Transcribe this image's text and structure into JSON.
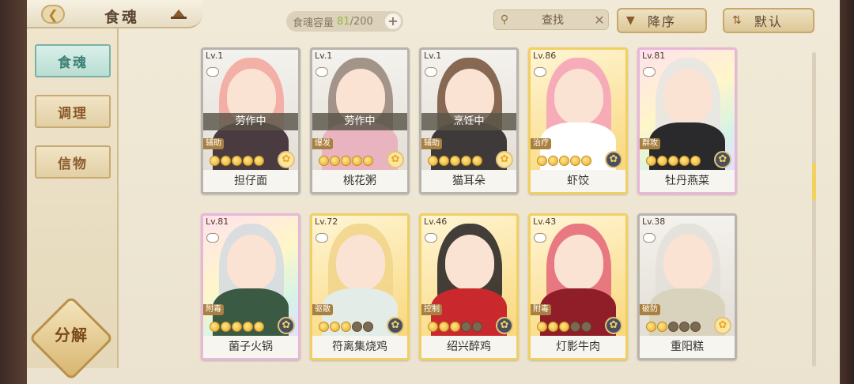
{
  "header": {
    "title": "食魂",
    "back_icon": "chevron-left-icon"
  },
  "capacity": {
    "label": "食魂容量",
    "current": "81",
    "max_text": "/200",
    "plus": "+"
  },
  "search": {
    "label": "查找",
    "close": "✕"
  },
  "sort": {
    "label": "降序",
    "icon": "▼"
  },
  "order": {
    "label": "默认",
    "icon": "⇅"
  },
  "sidebar": {
    "items": [
      {
        "label": "食魂",
        "active": true
      },
      {
        "label": "调理",
        "active": false
      },
      {
        "label": "信物",
        "active": false
      }
    ],
    "decompose": "分解"
  },
  "cards": [
    {
      "lv": "Lv.1",
      "name": "担仔面",
      "status": "劳作中",
      "role": "辅助",
      "stars_on": 5,
      "stars_total": 5,
      "element": "gold",
      "frame": "plain",
      "hair": "#f3a8a0",
      "body": "#4a3b40"
    },
    {
      "lv": "Lv.1",
      "name": "桃花粥",
      "status": "劳作中",
      "role": "爆发",
      "stars_on": 5,
      "stars_total": 5,
      "element": "gold",
      "frame": "plain",
      "hair": "#9a8a80",
      "body": "#e9b3c0"
    },
    {
      "lv": "Lv.1",
      "name": "猫耳朵",
      "status": "烹饪中",
      "role": "辅助",
      "stars_on": 5,
      "stars_total": 5,
      "element": "gold",
      "frame": "plain",
      "hair": "#7b5a43",
      "body": "#3e3a3a"
    },
    {
      "lv": "Lv.86",
      "name": "虾饺",
      "status": "",
      "role": "治疗",
      "stars_on": 5,
      "stars_total": 5,
      "element": "dark",
      "frame": "gold",
      "hair": "#f5a4b8",
      "body": "#ffffff"
    },
    {
      "lv": "Lv.81",
      "name": "牡丹燕菜",
      "status": "",
      "role": "群攻",
      "stars_on": 5,
      "stars_total": 5,
      "element": "dark",
      "frame": "rainbow",
      "hair": "#e8e6e2",
      "body": "#2a2a2c"
    },
    {
      "lv": "Lv.81",
      "name": "菌子火锅",
      "status": "",
      "role": "附毒",
      "stars_on": 5,
      "stars_total": 5,
      "element": "dark",
      "frame": "rainbow",
      "hair": "#d6dbe0",
      "body": "#3b5a44"
    },
    {
      "lv": "Lv.72",
      "name": "符离集烧鸡",
      "status": "",
      "role": "驱散",
      "stars_on": 3,
      "stars_total": 5,
      "element": "dark",
      "frame": "gold",
      "hair": "#f1d58c",
      "body": "#e3ece6"
    },
    {
      "lv": "Lv.46",
      "name": "绍兴醉鸡",
      "status": "",
      "role": "控制",
      "stars_on": 3,
      "stars_total": 5,
      "element": "dark",
      "frame": "gold",
      "hair": "#2f2a2a",
      "body": "#c9282d"
    },
    {
      "lv": "Lv.43",
      "name": "灯影牛肉",
      "status": "",
      "role": "附毒",
      "stars_on": 3,
      "stars_total": 5,
      "element": "dark",
      "frame": "gold",
      "hair": "#e56b7b",
      "body": "#8f1e28"
    },
    {
      "lv": "Lv.38",
      "name": "重阳糕",
      "status": "",
      "role": "破防",
      "stars_on": 2,
      "stars_total": 5,
      "element": "gold",
      "frame": "plain",
      "hair": "#e3e0d9",
      "body": "#d9d2bd"
    }
  ]
}
